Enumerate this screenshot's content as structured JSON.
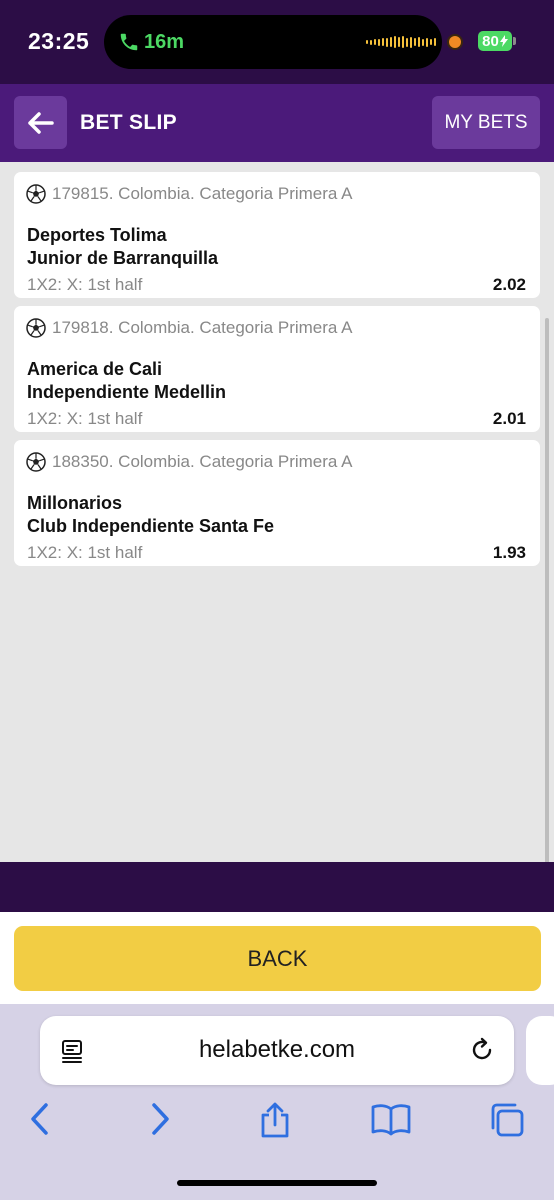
{
  "status": {
    "time": "23:25",
    "call_duration": "16m",
    "battery": "80"
  },
  "header": {
    "title": "BET SLIP",
    "my_bets": "MY BETS"
  },
  "bets": [
    {
      "event": "179815. Colombia. Categoria Primera A",
      "home": "Deportes Tolima",
      "away": "Junior de Barranquilla",
      "market": "1X2: X: 1st half",
      "odds": "2.02"
    },
    {
      "event": "179818. Colombia. Categoria Primera A",
      "home": "America de Cali",
      "away": "Independiente Medellin",
      "market": "1X2: X: 1st half",
      "odds": "2.01"
    },
    {
      "event": "188350. Colombia. Categoria Primera A",
      "home": "Millonarios",
      "away": "Club Independiente Santa Fe",
      "market": "1X2: X: 1st half",
      "odds": "1.93"
    }
  ],
  "footer": {
    "back_label": "BACK"
  },
  "browser": {
    "url": "helabetke.com"
  },
  "colors": {
    "status_bg": "#2c0d46",
    "header_bg": "#4b1a7a",
    "button_bg": "#6b3a9c",
    "back_button": "#f2cd44",
    "call_green": "#4cd964",
    "safari_blue": "#2f6fe0"
  }
}
